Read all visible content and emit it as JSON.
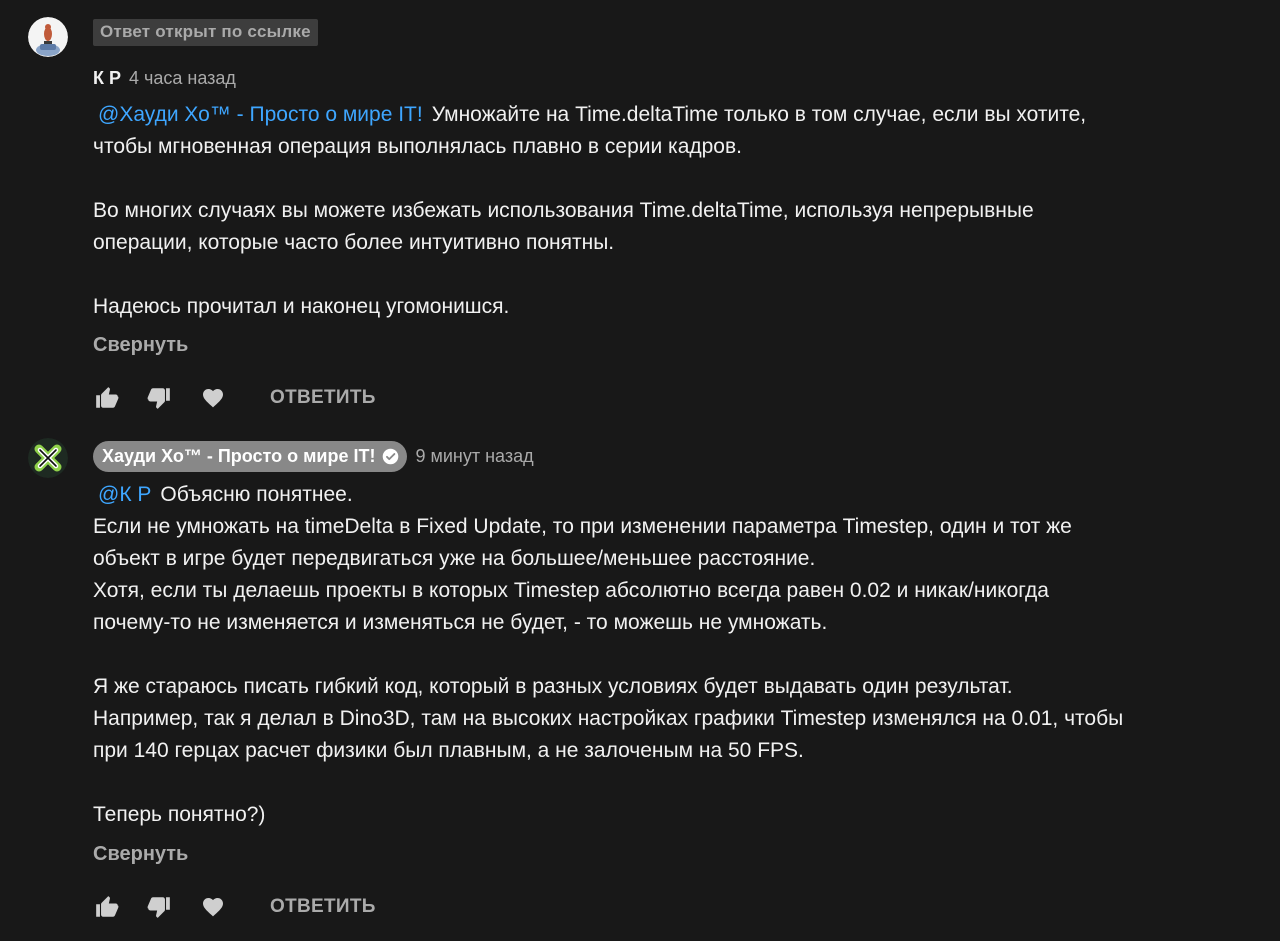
{
  "comment1": {
    "linked_badge": "Ответ открыт по ссылке",
    "author": "К Р",
    "time": "4 часа назад",
    "mention": "@Хауди Хо™ - Просто о мире IT!",
    "line1_rest": "Умножайте на Time.deltaTime только в том случае, если вы хотите,",
    "line2": "чтобы мгновенная операция выполнялась плавно в серии кадров.",
    "para2_line1": "Во многих случаях вы можете избежать использования Time.deltaTime, используя непрерывные",
    "para2_line2": "операции, которые часто более интуитивно понятны.",
    "para3": "Надеюсь прочитал и наконец угомонишся.",
    "collapse_label": "Свернуть",
    "reply_label": "ОТВЕТИТЬ",
    "icons": [
      "thumbs-up-icon",
      "thumbs-down-icon",
      "heart-icon"
    ]
  },
  "comment2": {
    "author": "Хауди Хо™ - Просто о мире IT!",
    "time": "9 минут назад",
    "mention": "@К Р",
    "line1_rest": "Объясню понятнее.",
    "line2": "Если не умножать на timeDelta в Fixed Update, то при изменении параметра Timestep, один и тот же",
    "line3": "объект в игре будет передвигаться уже на большее/меньшее расстояние.",
    "line4": "Хотя, если ты делаешь проекты в которых Timestep абсолютно всегда равен 0.02 и никак/никогда",
    "line5": "почему-то не изменяется и изменяться не будет, - то можешь не умножать.",
    "para2_line1": "Я же стараюсь писать гибкий код, который в разных условиях будет выдавать один результат.",
    "para2_line2": "Например, так я делал в Dino3D, там на высоких настройках графики Timestep изменялся на 0.01, чтобы",
    "para2_line3": "при 140 герцах расчет физики был плавным, а не залоченым на 50 FPS.",
    "para3": "Теперь понятно?)",
    "collapse_label": "Свернуть",
    "reply_label": "ОТВЕТИТЬ",
    "icons": [
      "thumbs-up-icon",
      "thumbs-down-icon",
      "heart-icon"
    ]
  },
  "colors": {
    "background": "#181818",
    "text": "#f1f1f1",
    "secondary_text": "#aaaaaa",
    "mention": "#3ea6ff",
    "author_chip": "#888888",
    "badge_bg": "#3d3d3d"
  }
}
